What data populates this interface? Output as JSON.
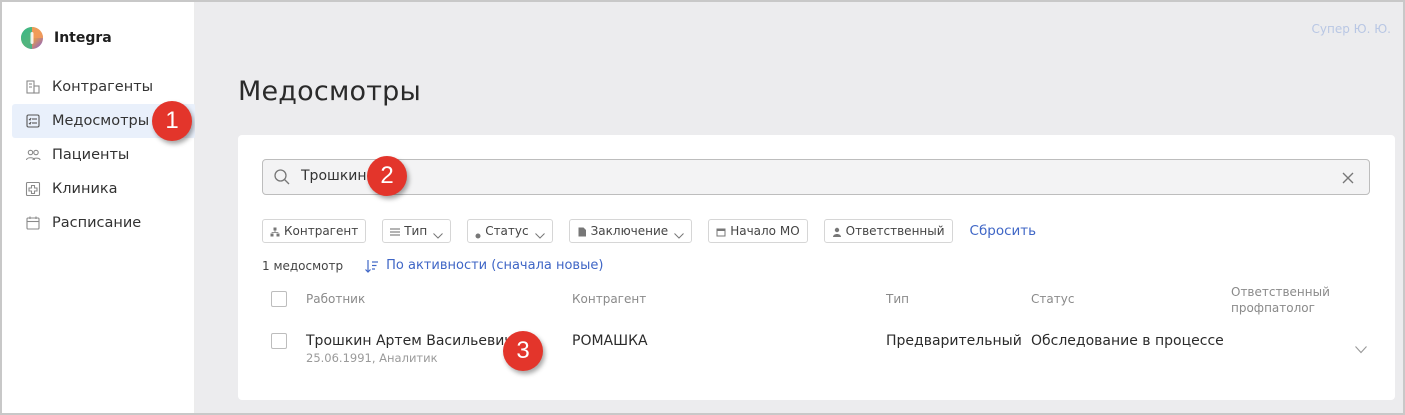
{
  "app": {
    "name": "Integra",
    "user": "Супер Ю. Ю."
  },
  "sidebar": {
    "items": [
      {
        "label": "Контрагенты",
        "icon": "building-icon",
        "active": false
      },
      {
        "label": "Медосмотры",
        "icon": "checklist-icon",
        "active": true
      },
      {
        "label": "Пациенты",
        "icon": "people-icon",
        "active": false
      },
      {
        "label": "Клиника",
        "icon": "hospital-icon",
        "active": false
      },
      {
        "label": "Расписание",
        "icon": "calendar-icon",
        "active": false
      }
    ]
  },
  "page": {
    "title": "Медосмотры"
  },
  "search": {
    "value": "Трошкин"
  },
  "filters": {
    "items": [
      "Контрагент",
      "Тип",
      "Статус",
      "Заключение",
      "Начало МО",
      "Ответственный"
    ],
    "reset_label": "Сбросить"
  },
  "list": {
    "count_label": "1 медосмотр",
    "sort_label": "По активности (сначала новые)"
  },
  "table": {
    "headers": [
      "Работник",
      "Контрагент",
      "Тип",
      "Статус",
      "Ответственный профпатолог"
    ],
    "rows": [
      {
        "worker": "Трошкин Артем Васильевич",
        "worker_sub": "25.06.1991, Аналитик",
        "counterparty": "РОМАШКА",
        "type": "Предварительный",
        "status": "Обследование в процессе",
        "responsible": ""
      }
    ]
  },
  "annotations": [
    "1",
    "2",
    "3"
  ],
  "colors": {
    "accent": "#3f66c6",
    "badge": "#e3352b",
    "active_bg": "#e9f0fb"
  }
}
